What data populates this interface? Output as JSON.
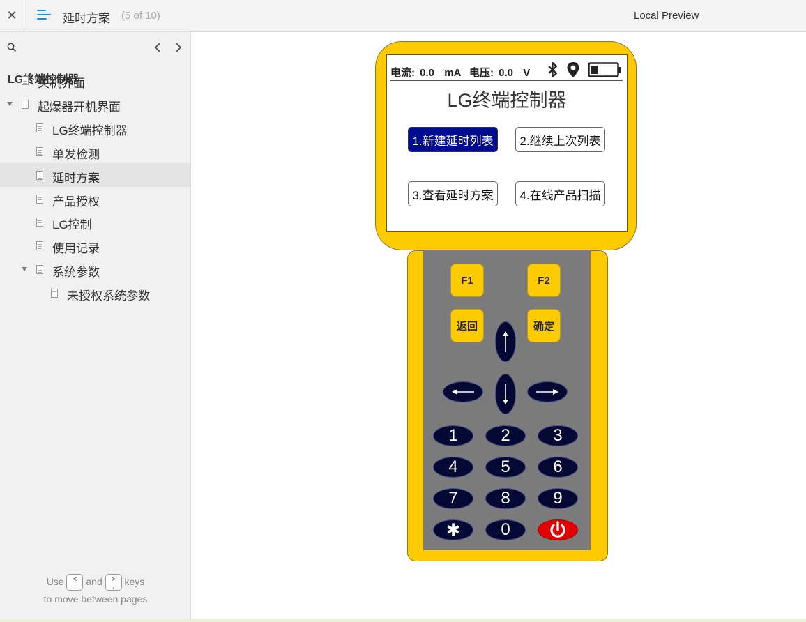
{
  "topbar": {
    "close_icon": "close-icon",
    "title": "延时方案",
    "count": "(5 of 10)",
    "preview": "Local Preview"
  },
  "sidebar": {
    "root": "LG终端控制器",
    "items": [
      {
        "label": "关机界面",
        "level": 1,
        "expanded": null,
        "selected": false
      },
      {
        "label": "起爆器开机界面",
        "level": 1,
        "expanded": true,
        "selected": false
      },
      {
        "label": "LG终端控制器",
        "level": 2,
        "expanded": null,
        "selected": false
      },
      {
        "label": "单发检测",
        "level": 2,
        "expanded": null,
        "selected": false
      },
      {
        "label": "延时方案",
        "level": 2,
        "expanded": null,
        "selected": true
      },
      {
        "label": "产品授权",
        "level": 2,
        "expanded": null,
        "selected": false
      },
      {
        "label": "LG控制",
        "level": 2,
        "expanded": null,
        "selected": false
      },
      {
        "label": "使用记录",
        "level": 2,
        "expanded": null,
        "selected": false
      },
      {
        "label": "系统参数",
        "level": 2,
        "expanded": true,
        "selected": false
      },
      {
        "label": "未授权系统参数",
        "level": 3,
        "expanded": null,
        "selected": false
      }
    ],
    "footer": {
      "use": "Use",
      "key_prev": "<\n,",
      "and": "and",
      "key_next": ">\n.",
      "keys": "keys",
      "line2": "to move between pages"
    }
  },
  "device": {
    "status": {
      "current_label": "电流:",
      "current_value": "0.0",
      "current_unit": "mA",
      "voltage_label": "电压:",
      "voltage_value": "0.0",
      "voltage_unit": "V",
      "battery_level": 0.25
    },
    "title": "LG终端控制器",
    "menu": [
      {
        "label": "1.新建延时列表",
        "active": true
      },
      {
        "label": "2.继续上次列表",
        "active": false
      },
      {
        "label": "3.查看延时方案",
        "active": false
      },
      {
        "label": "4.在线产品扫描",
        "active": false
      }
    ],
    "keys": {
      "f1": "F1",
      "f2": "F2",
      "back": "返回",
      "ok": "确定",
      "numbers": [
        "1",
        "2",
        "3",
        "4",
        "5",
        "6",
        "7",
        "8",
        "9"
      ],
      "star": "✱",
      "zero": "0"
    }
  },
  "colors": {
    "device_yellow": "#fecb00",
    "keypad_gray": "#7b7b7b",
    "key_navy": "#060834",
    "active_blue": "#000c8f",
    "power_red": "#e30000"
  }
}
